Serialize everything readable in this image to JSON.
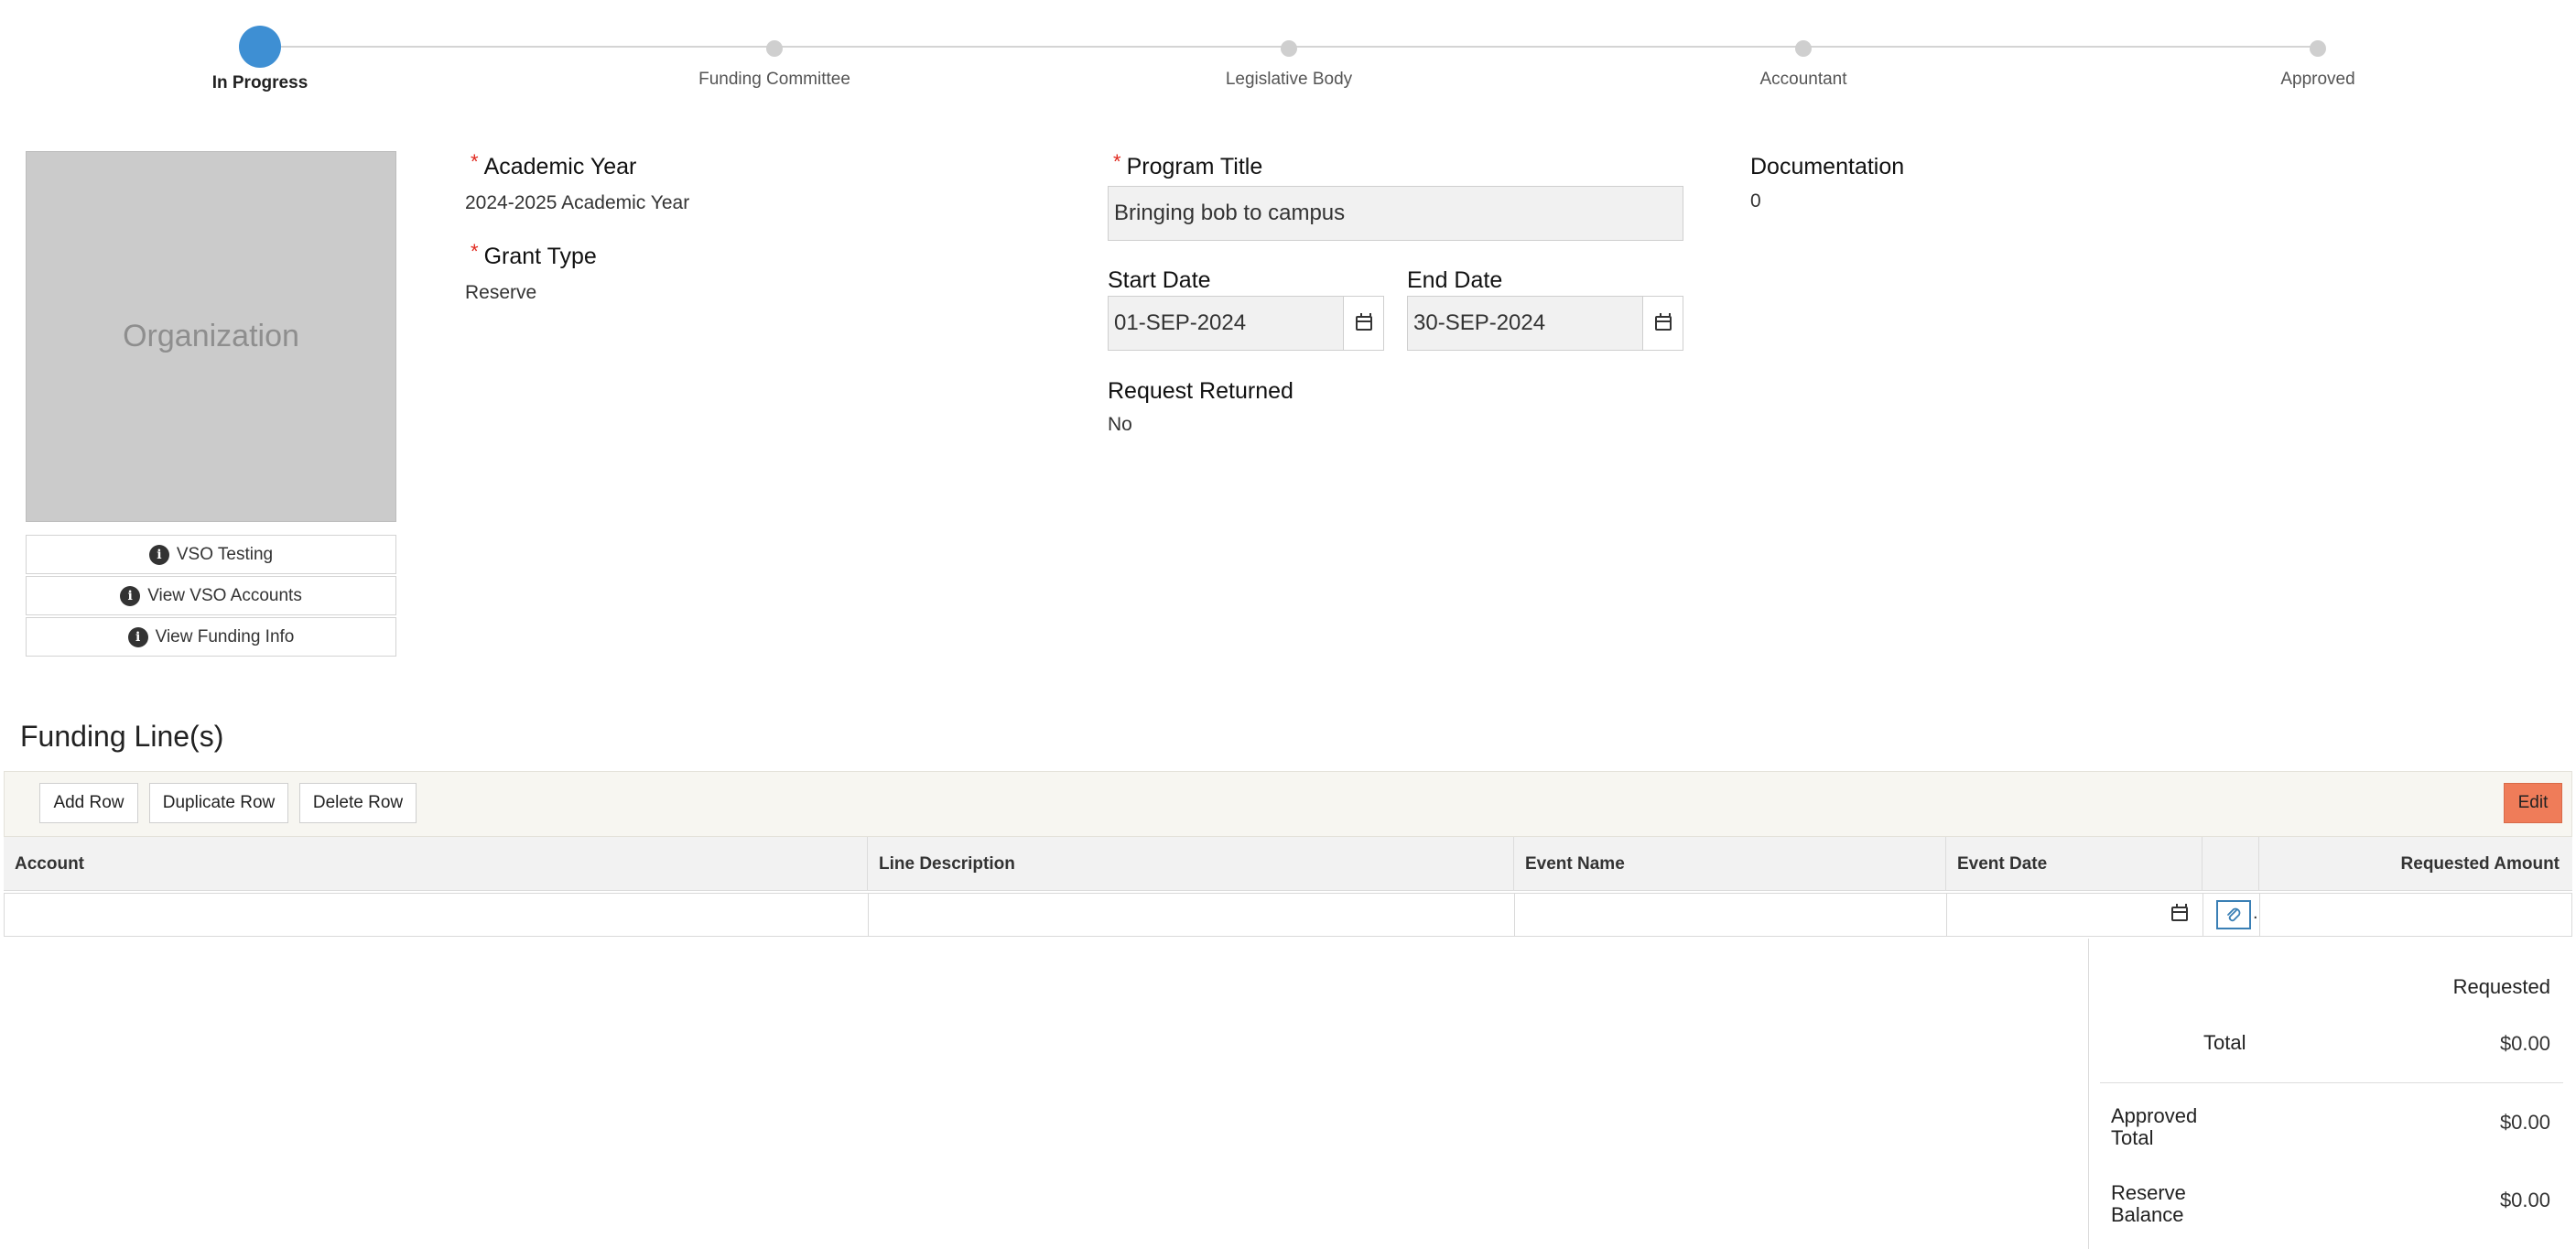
{
  "stepper": {
    "steps": [
      {
        "label": "In Progress",
        "active": true
      },
      {
        "label": "Funding Committee",
        "active": false
      },
      {
        "label": "Legislative Body",
        "active": false
      },
      {
        "label": "Accountant",
        "active": false
      },
      {
        "label": "Approved",
        "active": false
      }
    ],
    "active_color": "#3e8fd3",
    "inactive_color": "#cfcfcf"
  },
  "organization": {
    "placeholder": "Organization",
    "buttons": [
      "VSO Testing",
      "View VSO Accounts",
      "View Funding Info"
    ],
    "info_icon": "i"
  },
  "form": {
    "academic_year": {
      "label": "Academic Year",
      "value": "2024-2025 Academic Year",
      "required": "*"
    },
    "grant_type": {
      "label": "Grant Type",
      "value": "Reserve",
      "required": "*"
    },
    "program_title": {
      "label": "Program Title",
      "value": "Bringing bob to campus",
      "required": "*"
    },
    "start_date": {
      "label": "Start Date",
      "value": "01-SEP-2024"
    },
    "end_date": {
      "label": "End Date",
      "value": "30-SEP-2024"
    },
    "request_returned": {
      "label": "Request Returned",
      "value": "No"
    },
    "documentation": {
      "label": "Documentation",
      "value": "0"
    }
  },
  "funding_lines": {
    "title": "Funding Line(s)",
    "toolbar": {
      "add_row": "Add Row",
      "duplicate_row": "Duplicate Row",
      "delete_row": "Delete Row",
      "edit": "Edit"
    },
    "columns": [
      "Account",
      "Line Description",
      "Event Name",
      "Event Date",
      "",
      "Requested Amount"
    ],
    "edit_color": "#ef7c59",
    "attach_icon": "paperclip-icon",
    "row_trailing": "."
  },
  "totals": {
    "header": "Requested",
    "total_label": "Total",
    "total_value": "$0.00",
    "approved_label_1": "Approved",
    "approved_label_2": "Total",
    "approved_value": "$0.00",
    "reserve_label_1": "Reserve",
    "reserve_label_2": "Balance",
    "reserve_value": "$0.00"
  }
}
